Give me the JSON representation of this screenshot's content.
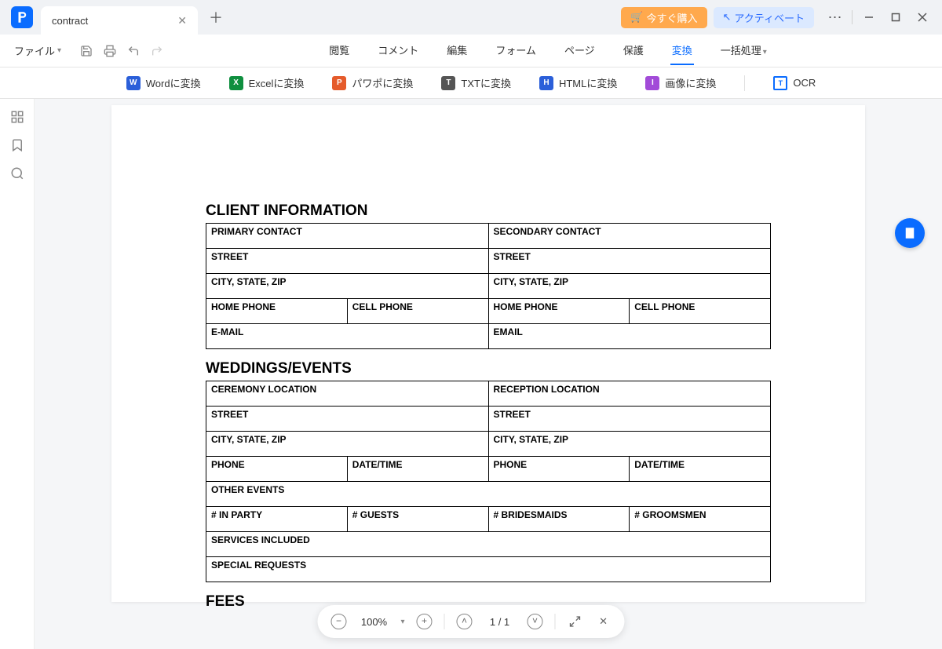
{
  "titlebar": {
    "tab_name": "contract",
    "buy_label": "今すぐ購入",
    "activate_label": "アクティベート"
  },
  "menubar": {
    "file": "ファイル",
    "items": [
      "閲覧",
      "コメント",
      "編集",
      "フォーム",
      "ページ",
      "保護",
      "変換",
      "一括処理"
    ],
    "active_index": 6
  },
  "convertbar": {
    "items": [
      {
        "label": "Wordに変換",
        "color": "#2b5fd9",
        "letter": "W"
      },
      {
        "label": "Excelに変換",
        "color": "#0f8f3f",
        "letter": "X"
      },
      {
        "label": "パワポに変換",
        "color": "#e55b2b",
        "letter": "P"
      },
      {
        "label": "TXTに変換",
        "color": "#555555",
        "letter": "T"
      },
      {
        "label": "HTMLに変換",
        "color": "#2b5fd9",
        "letter": "H"
      },
      {
        "label": "画像に変換",
        "color": "#a24bd8",
        "letter": "I"
      }
    ],
    "ocr_label": "OCR"
  },
  "document": {
    "sections": {
      "client_info": {
        "title": "CLIENT INFORMATION",
        "primary_contact": "PRIMARY CONTACT",
        "secondary_contact": "SECONDARY CONTACT",
        "street": "STREET",
        "city_state_zip": "CITY, STATE, ZIP",
        "home_phone": "HOME PHONE",
        "cell_phone": "CELL PHONE",
        "email1": "E-MAIL",
        "email2": "EMAIL"
      },
      "weddings": {
        "title": "WEDDINGS/EVENTS",
        "ceremony": "CEREMONY LOCATION",
        "reception": "RECEPTION LOCATION",
        "street": "STREET",
        "city_state_zip": "CITY, STATE, ZIP",
        "phone": "PHONE",
        "date_time": "DATE/TIME",
        "other_events": "OTHER EVENTS",
        "in_party": "# IN PARTY",
        "guests": "# GUESTS",
        "bridesmaids": "# BRIDESMAIDS",
        "groomsmen": "# GROOMSMEN",
        "services": "SERVICES INCLUDED",
        "special": "SPECIAL REQUESTS"
      },
      "fees": {
        "title": "FEES"
      }
    }
  },
  "bottombar": {
    "zoom": "100%",
    "page": "1 / 1"
  }
}
